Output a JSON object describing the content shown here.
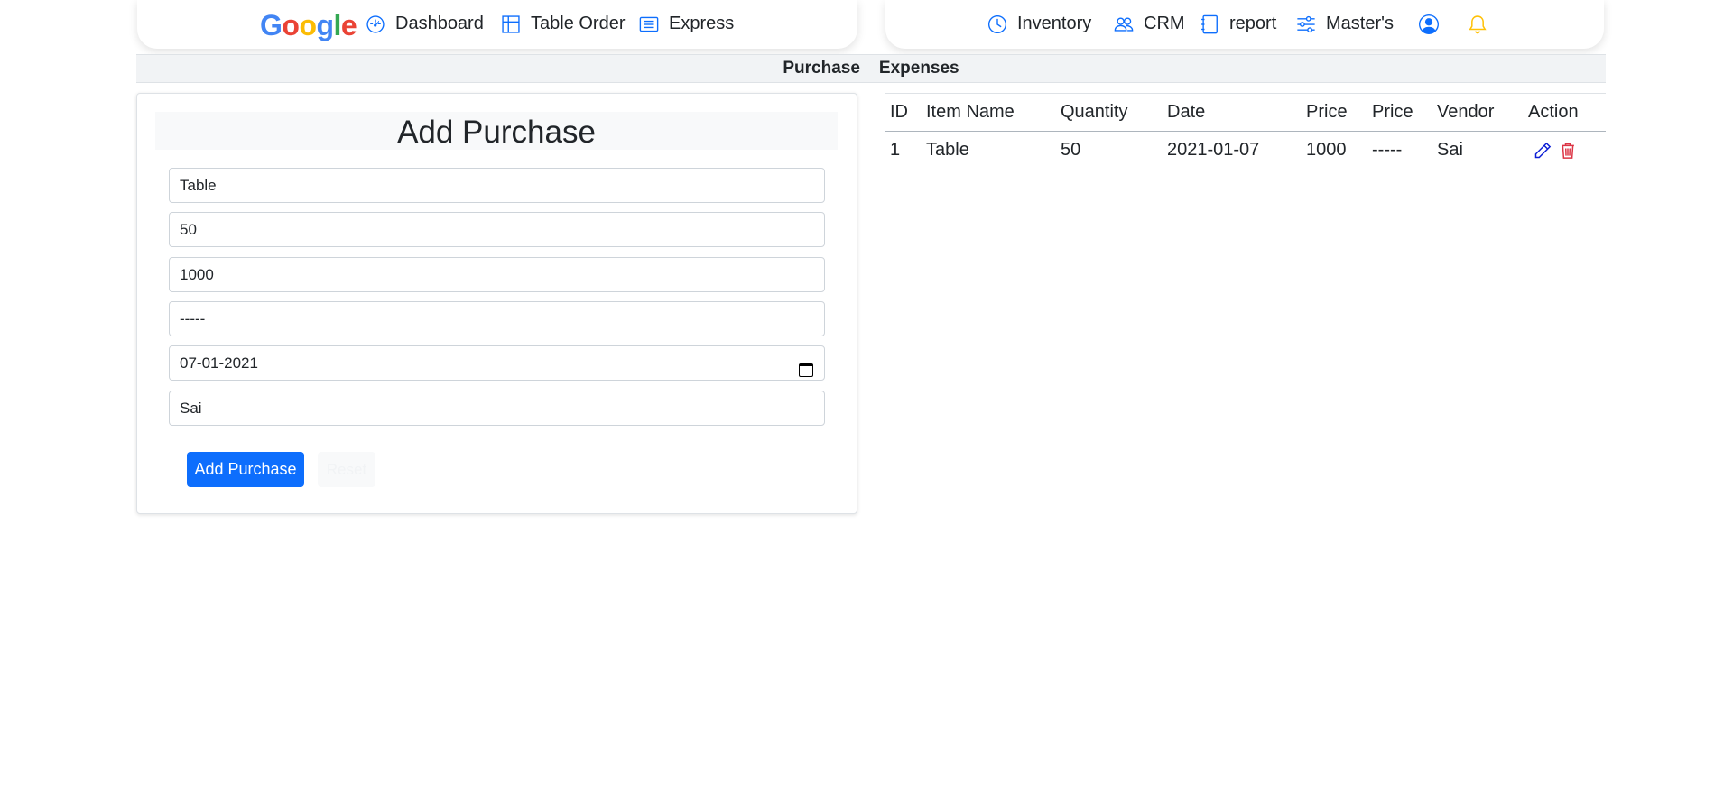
{
  "brand": {
    "logo_letters": [
      "G",
      "o",
      "o",
      "g",
      "l",
      "e"
    ],
    "logo_colors": [
      "#4285F4",
      "#EA4335",
      "#FBBC05",
      "#4285F4",
      "#34A853",
      "#EA4335"
    ]
  },
  "nav_left": [
    {
      "label": "Dashboard",
      "icon": "speedometer-icon"
    },
    {
      "label": "Table Order",
      "icon": "grid-icon"
    },
    {
      "label": "Express",
      "icon": "list-card-icon"
    }
  ],
  "nav_right": [
    {
      "label": "Inventory",
      "icon": "clock-icon"
    },
    {
      "label": "CRM",
      "icon": "people-icon"
    },
    {
      "label": "report",
      "icon": "journal-icon"
    },
    {
      "label": "Master's",
      "icon": "sliders-icon"
    }
  ],
  "nav_right_icons": [
    "user-circle-icon",
    "bell-icon"
  ],
  "subnav": [
    "Purchase",
    "Expenses"
  ],
  "form": {
    "title": "Add Purchase",
    "fields": [
      {
        "name": "item-name-field",
        "value": "Table"
      },
      {
        "name": "quantity-field",
        "value": "50"
      },
      {
        "name": "price-field",
        "value": "1000"
      },
      {
        "name": "price2-field",
        "value": "-----"
      },
      {
        "name": "date-field",
        "value": "07-01-2021"
      },
      {
        "name": "vendor-field",
        "value": "Sai"
      }
    ],
    "submit_label": "Add Purchase",
    "reset_label": "Reset"
  },
  "table": {
    "headers": [
      "ID",
      "Item Name",
      "Quantity",
      "Date",
      "Price",
      "Price",
      "Vendor",
      "Action"
    ],
    "rows": [
      [
        "1",
        "Table",
        "50",
        "2021-01-07",
        "1000",
        "-----",
        "Sai"
      ]
    ]
  },
  "colors": {
    "accent": "#0d6efd",
    "edit_icon": "#0d1fd6",
    "delete_icon": "#dc3545",
    "bell": "#ffc107"
  }
}
